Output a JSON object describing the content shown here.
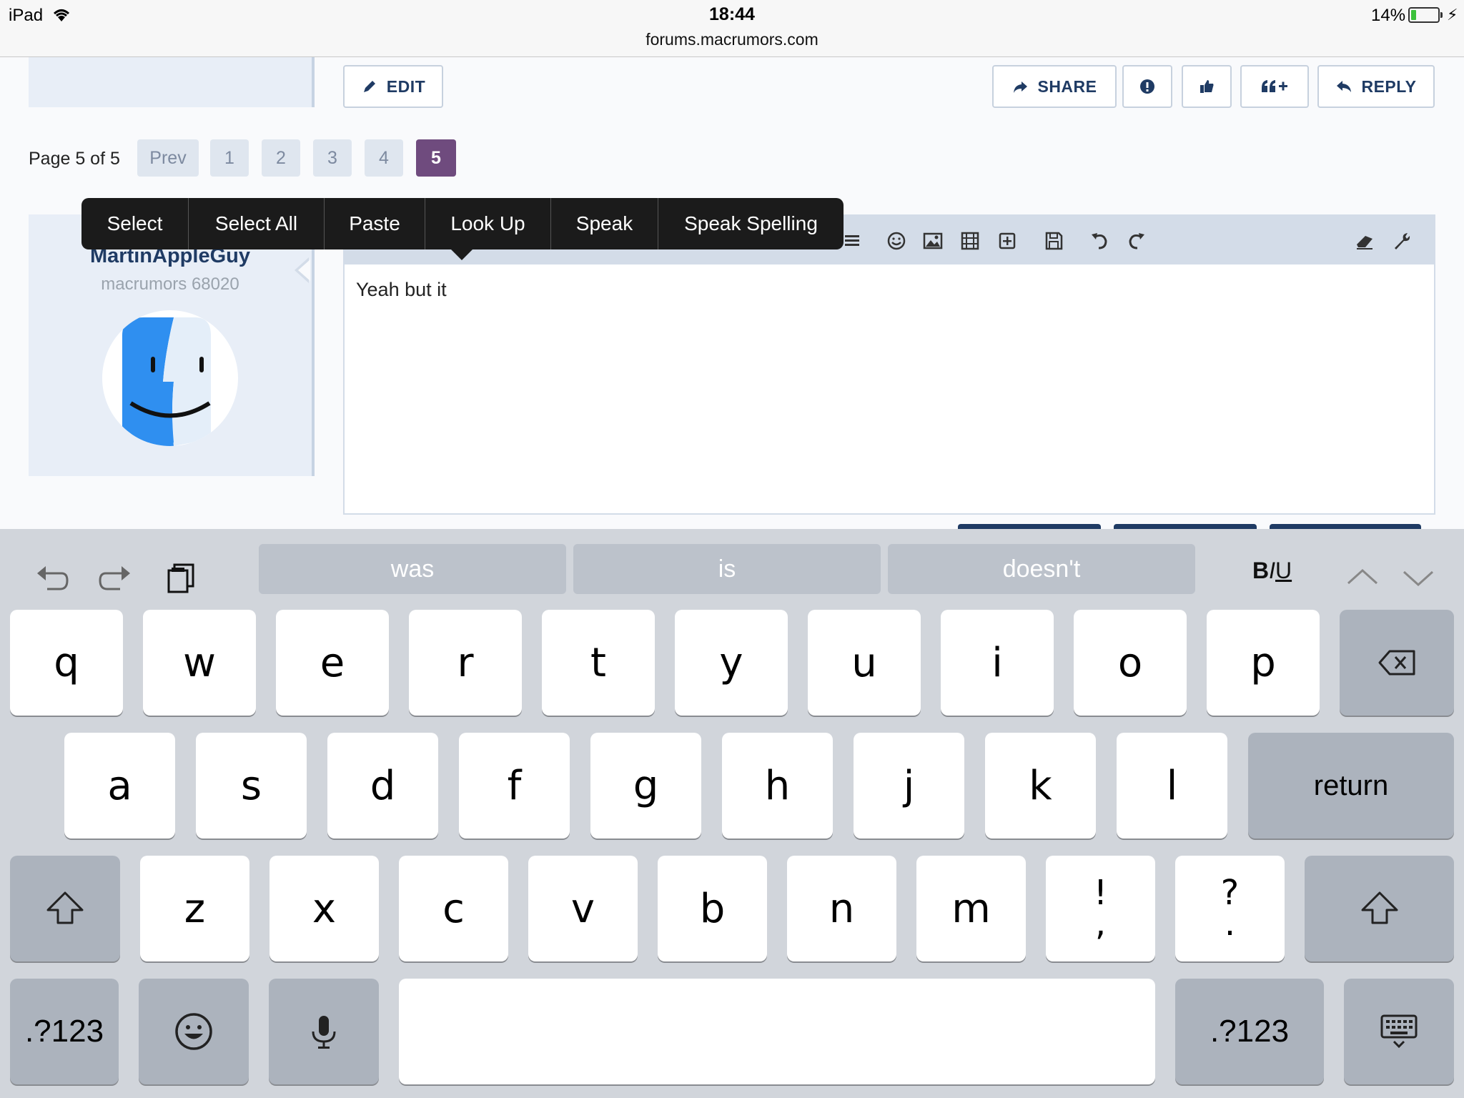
{
  "status_bar": {
    "device": "iPad",
    "time": "18:44",
    "url": "forums.macrumors.com",
    "battery": "14%"
  },
  "post_actions": {
    "edit": "EDIT",
    "share": "SHARE",
    "reply": "REPLY"
  },
  "pagination": {
    "label": "Page 5 of 5",
    "prev": "Prev",
    "pages": [
      "1",
      "2",
      "3",
      "4",
      "5"
    ],
    "current": "5"
  },
  "user": {
    "name": "MartinAppleGuy",
    "title": "macrumors 68020"
  },
  "editor": {
    "text": "Yeah but it"
  },
  "edit_menu": [
    "Select",
    "Select All",
    "Paste",
    "Look Up",
    "Speak",
    "Speak Spelling"
  ],
  "keyboard": {
    "suggestions": [
      "was",
      "is",
      "doesn't"
    ],
    "row1": [
      "q",
      "w",
      "e",
      "r",
      "t",
      "y",
      "u",
      "i",
      "o",
      "p"
    ],
    "row2": [
      "a",
      "s",
      "d",
      "f",
      "g",
      "h",
      "j",
      "k",
      "l"
    ],
    "row3": [
      "z",
      "x",
      "c",
      "v",
      "b",
      "n",
      "m"
    ],
    "punct1": {
      "top": "!",
      "bottom": ","
    },
    "punct2": {
      "top": "?",
      "bottom": "."
    },
    "return": "return",
    "numbers": ".?123",
    "format": {
      "b": "B",
      "i": "I",
      "u": "U"
    }
  },
  "colors": {
    "accent": "#1f3b64",
    "current_page": "#6f4b7e",
    "keyboard_bg": "#d1d5db"
  }
}
